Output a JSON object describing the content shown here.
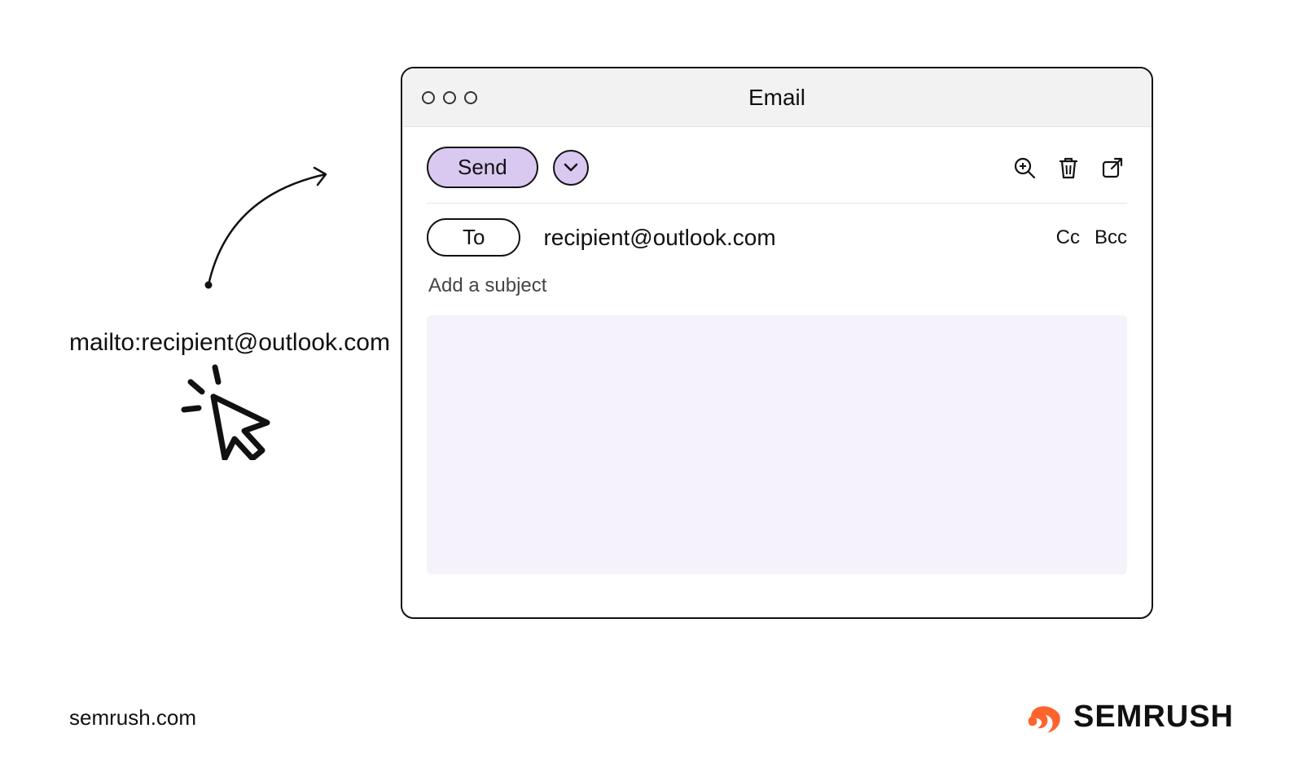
{
  "mailto_link_text": "mailto:recipient@outlook.com",
  "window": {
    "title": "Email",
    "toolbar": {
      "send_label": "Send"
    },
    "to_label": "To",
    "recipient": "recipient@outlook.com",
    "cc_label": "Cc",
    "bcc_label": "Bcc",
    "subject_placeholder": "Add a subject"
  },
  "footer": {
    "url": "semrush.com",
    "brand": "SEMRUSH"
  },
  "colors": {
    "accent_lavender": "#d9c8f0",
    "body_area_bg": "#f6f2fb",
    "brand_orange": "#ff642d"
  }
}
